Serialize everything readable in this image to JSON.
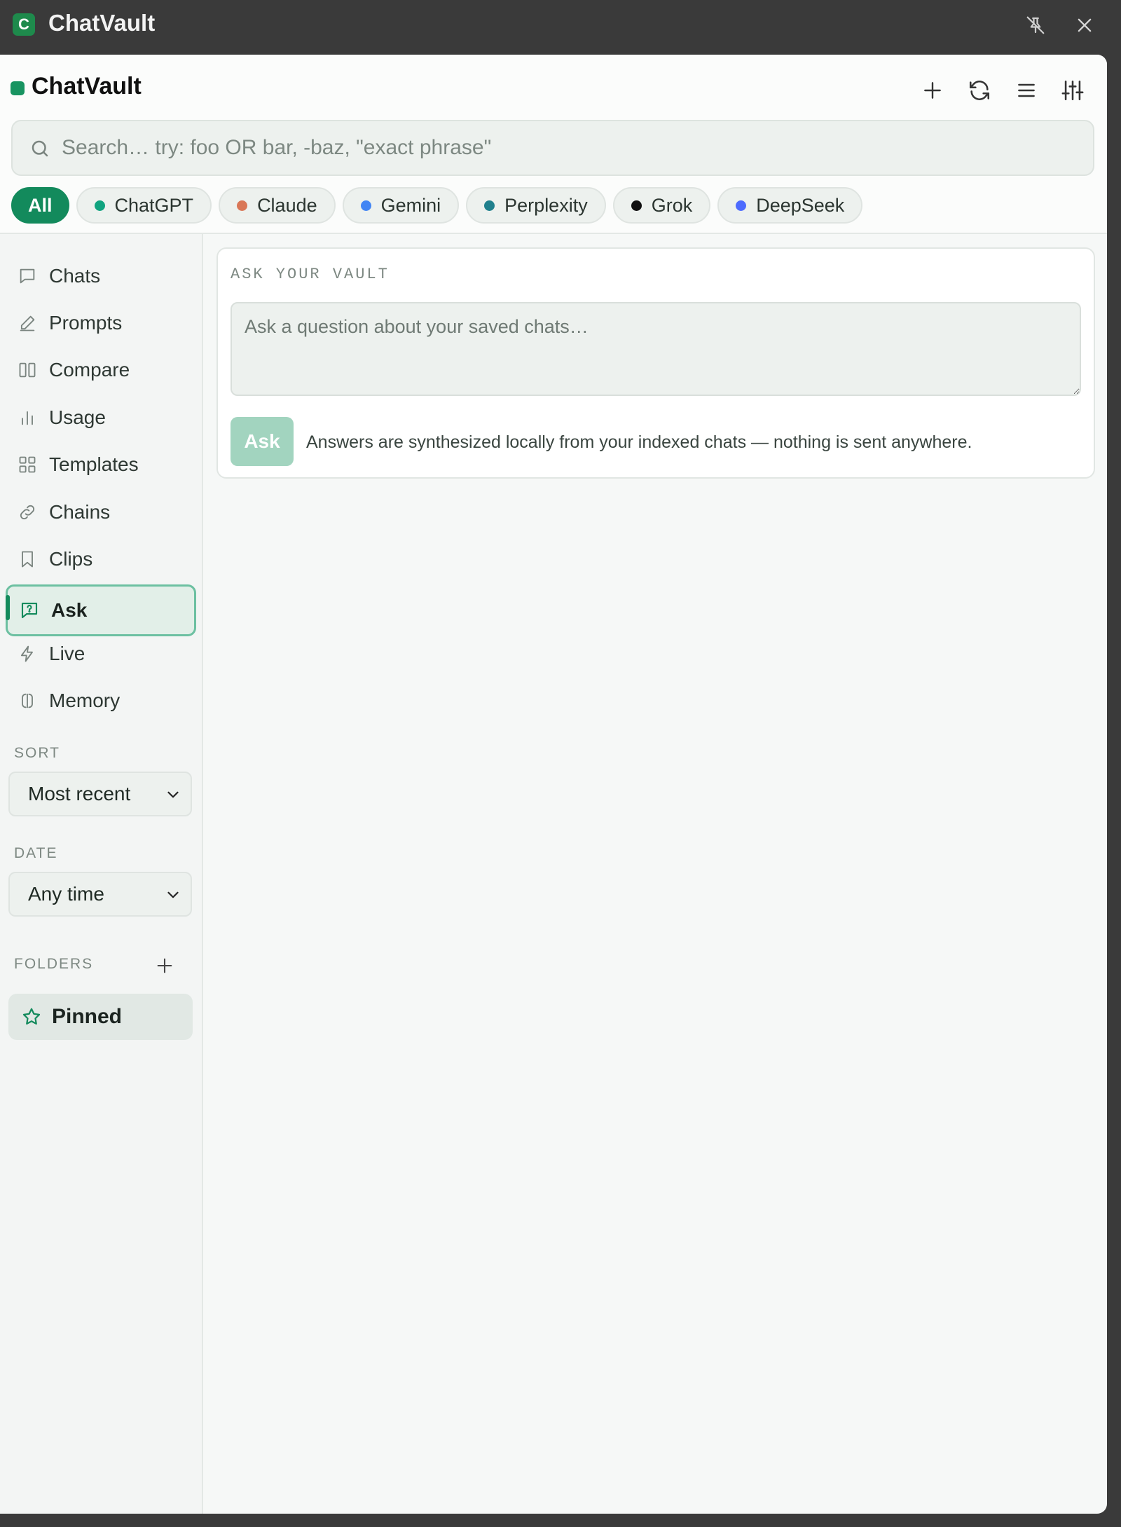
{
  "window": {
    "title": "ChatVault",
    "icon_letter": "C"
  },
  "header": {
    "brand": "ChatVault"
  },
  "search": {
    "placeholder": "Search… try: foo OR bar, -baz, \"exact phrase\""
  },
  "filters": [
    {
      "label": "All",
      "active": true
    },
    {
      "label": "ChatGPT",
      "color": "#10a37f"
    },
    {
      "label": "Claude",
      "color": "#d97757"
    },
    {
      "label": "Gemini",
      "color": "#4285f4"
    },
    {
      "label": "Perplexity",
      "color": "#20808d"
    },
    {
      "label": "Grok",
      "color": "#111111"
    },
    {
      "label": "DeepSeek",
      "color": "#4d6bfe"
    }
  ],
  "sidebar": {
    "items": [
      {
        "label": "Chats",
        "icon": "chat-bubble-icon"
      },
      {
        "label": "Prompts",
        "icon": "pencil-icon"
      },
      {
        "label": "Compare",
        "icon": "columns-icon"
      },
      {
        "label": "Usage",
        "icon": "bar-chart-icon"
      },
      {
        "label": "Templates",
        "icon": "grid-icon"
      },
      {
        "label": "Chains",
        "icon": "link-icon"
      },
      {
        "label": "Clips",
        "icon": "bookmark-icon"
      },
      {
        "label": "Ask",
        "icon": "question-bubble-icon",
        "active": true
      },
      {
        "label": "Live",
        "icon": "lightning-icon"
      },
      {
        "label": "Memory",
        "icon": "brain-icon"
      }
    ],
    "sort_label": "SORT",
    "sort_value": "Most recent",
    "date_label": "DATE",
    "date_value": "Any time",
    "folders_label": "FOLDERS",
    "folders": [
      {
        "label": "Pinned",
        "icon": "star-icon"
      }
    ]
  },
  "ask": {
    "heading": "ASK YOUR VAULT",
    "placeholder": "Ask a question about your saved chats…",
    "button": "Ask",
    "note": "Answers are synthesized locally from your indexed chats — nothing is sent anywhere."
  },
  "colors": {
    "accent": "#138a5c",
    "accent_light": "#a2d4bf",
    "active_border": "#6cc0a1"
  }
}
